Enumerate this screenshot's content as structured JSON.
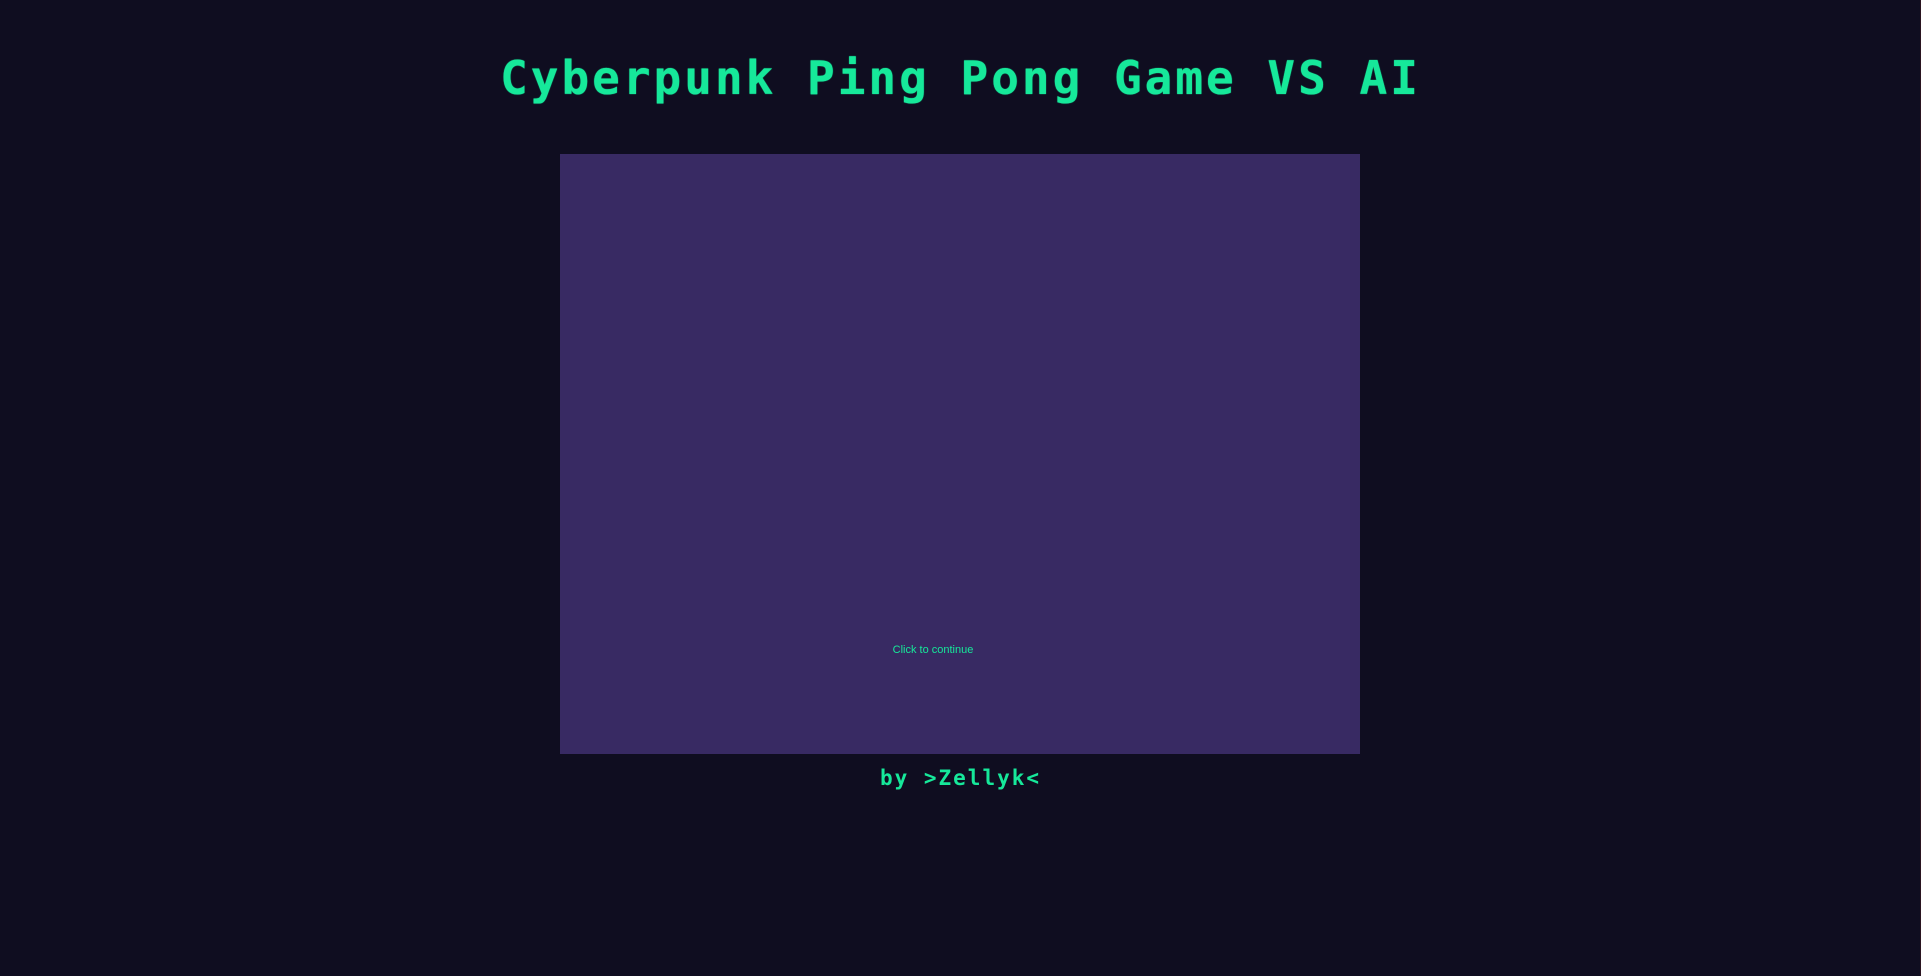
{
  "page": {
    "title": "Cyberpunk Ping Pong Game VS AI",
    "footer": "by >Zellyk<"
  },
  "game": {
    "prompt": "Click to continue"
  },
  "colors": {
    "background": "#0f0d20",
    "canvas": "#382a63",
    "accent": "#16e89a"
  }
}
